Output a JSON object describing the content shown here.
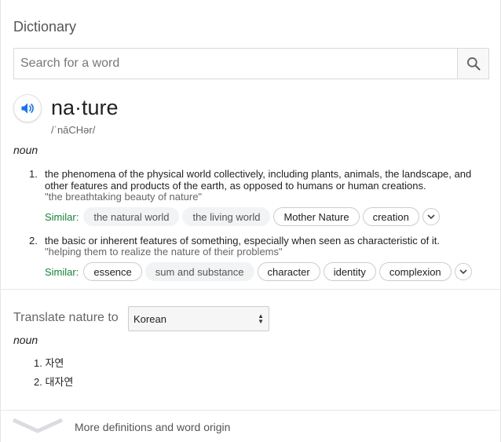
{
  "header": {
    "title": "Dictionary"
  },
  "search": {
    "placeholder": "Search for a word",
    "value": ""
  },
  "entry": {
    "word": "na·ture",
    "phonetic": "/ˈnāCHər/",
    "part_of_speech": "noun",
    "definitions": [
      {
        "number": "1.",
        "line1": "the phenomena of the physical world collectively, including plants, animals, the landscape, and",
        "line2": "other features and products of the earth, as opposed to humans or human creations.",
        "example": "\"the breathtaking beauty of nature\"",
        "similar_label": "Similar:",
        "similar": [
          "the natural world",
          "the living world",
          "Mother Nature",
          "creation"
        ]
      },
      {
        "number": "2.",
        "line1": "the basic or inherent features of something, especially when seen as characteristic of it.",
        "example": "\"helping them to realize the nature of their problems\"",
        "similar_label": "Similar:",
        "similar": [
          "essence",
          "sum and substance",
          "character",
          "identity",
          "complexion"
        ]
      }
    ]
  },
  "translate": {
    "label": "Translate nature to",
    "language": "Korean",
    "part_of_speech": "noun",
    "items": [
      "1. 자연",
      "2. 대자연"
    ]
  },
  "footer": {
    "more_label": "More definitions and word origin"
  },
  "colors": {
    "accent": "#1a73e8",
    "similar_green": "#188038",
    "chip_bg": "#f1f3f4"
  }
}
